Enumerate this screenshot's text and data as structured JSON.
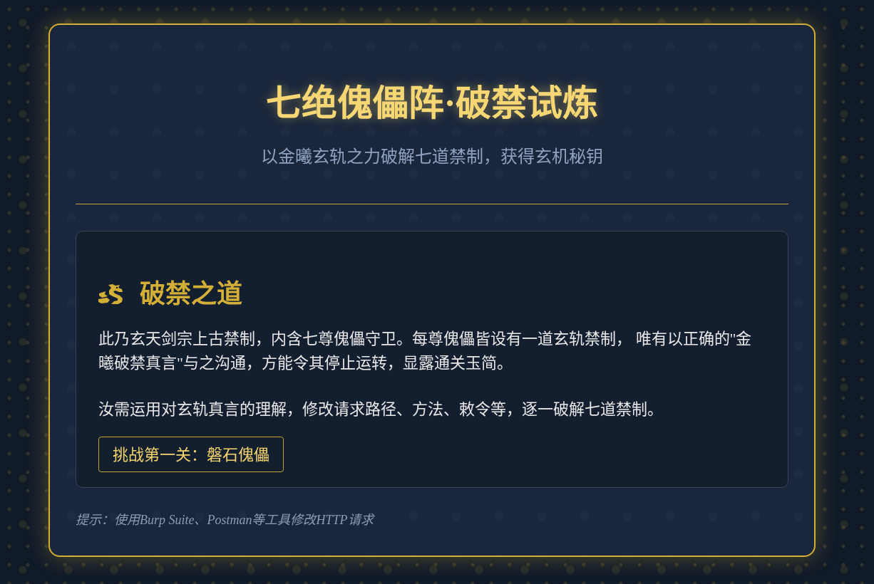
{
  "header": {
    "title": "七绝傀儡阵·破禁试炼",
    "subtitle": "以金曦玄轨之力破解七道禁制，获得玄机秘钥"
  },
  "section": {
    "heading": "破禁之道",
    "paragraphs": [
      "此乃玄天剑宗上古禁制，内含七尊傀儡守卫。每尊傀儡皆设有一道玄轨禁制， 唯有以正确的\"金曦破禁真言\"与之沟通，方能令其停止运转，显露通关玉简。",
      "汝需运用对玄轨真言的理解，修改请求路径、方法、敕令等，逐一破解七道禁制。"
    ],
    "button": "挑战第一关：磐石傀儡"
  },
  "hint": "提示：使用Burp Suite、Postman等工具修改HTTP请求"
}
